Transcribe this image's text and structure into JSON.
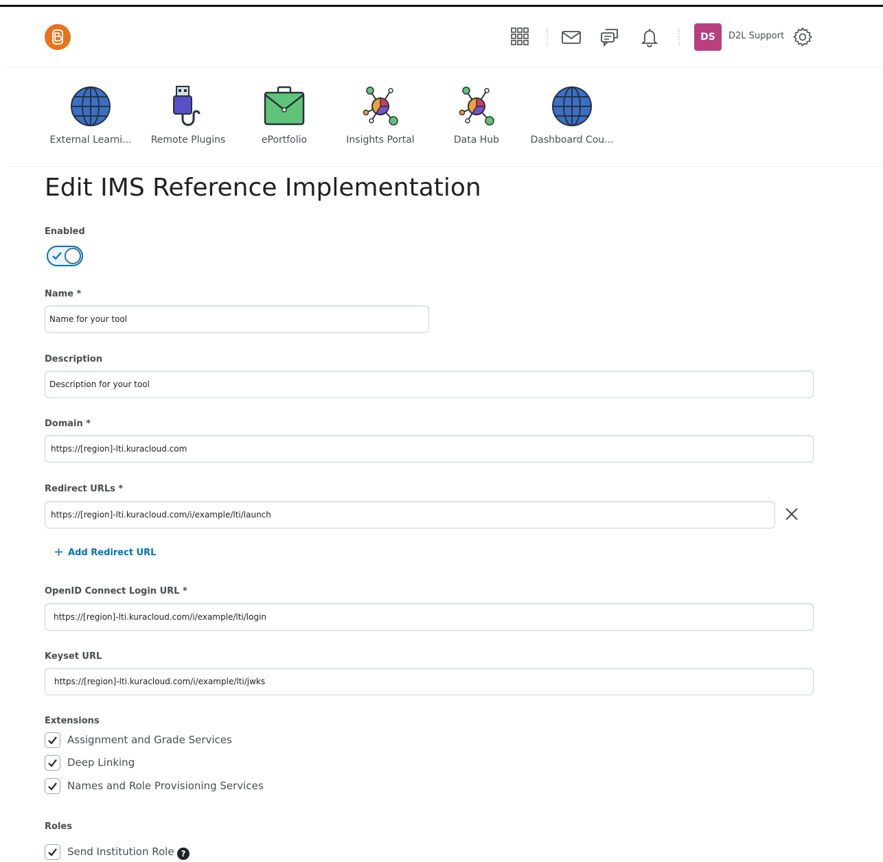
{
  "header": {
    "user_initials": "DS",
    "user_name": "D2L Support",
    "avatar_color": "#b8407f",
    "logo_color": "#e8731c",
    "icons": [
      "app-grid-icon",
      "mail-icon",
      "chat-icon",
      "bell-icon",
      "gear-icon"
    ]
  },
  "nav": {
    "items": [
      {
        "label": "External Learni...",
        "icon": "globe-icon"
      },
      {
        "label": "Remote Plugins",
        "icon": "usb-plug-icon"
      },
      {
        "label": "ePortfolio",
        "icon": "briefcase-icon"
      },
      {
        "label": "Insights Portal",
        "icon": "network-chart-icon"
      },
      {
        "label": "Data Hub",
        "icon": "network-chart-icon"
      },
      {
        "label": "Dashboard Cou...",
        "icon": "globe-icon"
      }
    ]
  },
  "page": {
    "title": "Edit IMS Reference Implementation"
  },
  "form": {
    "enabled_label": "Enabled",
    "enabled": true,
    "name_label": "Name *",
    "name_value": "Name for your tool",
    "description_label": "Description",
    "description_value": "Description for your tool",
    "domain_label": "Domain *",
    "domain_value": "https://[region]-lti.kuracloud.com",
    "redirect_label": "Redirect URLs *",
    "redirect_value": "https://[region]-lti.kuracloud.com/i/example/lti/launch",
    "add_redirect": "Add Redirect URL",
    "openid_label": "OpenID Connect Login URL *",
    "openid_value": "https://[region]-lti.kuracloud.com/i/example/lti/login",
    "keyset_label": "Keyset URL",
    "keyset_value": "https://[region]-lti.kuracloud.com/i/example/lti/jwks",
    "extensions_label": "Extensions",
    "extensions": [
      {
        "label": "Assignment and Grade Services",
        "checked": true
      },
      {
        "label": "Deep Linking",
        "checked": true
      },
      {
        "label": "Names and Role Provisioning Services",
        "checked": true
      }
    ],
    "roles_label": "Roles",
    "roles": [
      {
        "label": "Send Institution Role",
        "checked": true
      }
    ],
    "help_glyph": "?"
  },
  "colors": {
    "accent": "#006fbf",
    "text": "#202122",
    "muted": "#494c4e"
  }
}
